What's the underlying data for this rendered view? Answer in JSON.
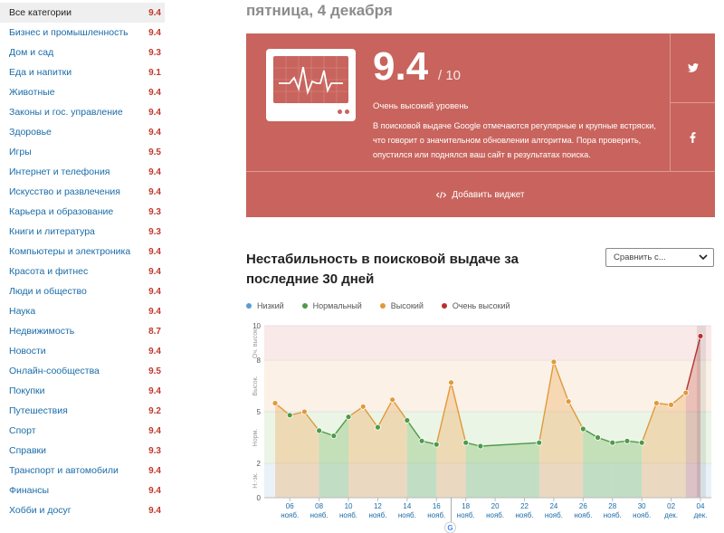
{
  "sidebar": {
    "categories": [
      {
        "label": "Все категории",
        "value": "9.4",
        "active": true
      },
      {
        "label": "Бизнес и промышленность",
        "value": "9.4"
      },
      {
        "label": "Дом и сад",
        "value": "9.3"
      },
      {
        "label": "Еда и напитки",
        "value": "9.1"
      },
      {
        "label": "Животные",
        "value": "9.4"
      },
      {
        "label": "Законы и гос. управление",
        "value": "9.4"
      },
      {
        "label": "Здоровье",
        "value": "9.4"
      },
      {
        "label": "Игры",
        "value": "9.5"
      },
      {
        "label": "Интернет и телефония",
        "value": "9.4"
      },
      {
        "label": "Искусство и развлечения",
        "value": "9.4"
      },
      {
        "label": "Карьера и образование",
        "value": "9.3"
      },
      {
        "label": "Книги и литература",
        "value": "9.3"
      },
      {
        "label": "Компьютеры и электроника",
        "value": "9.4"
      },
      {
        "label": "Красота и фитнес",
        "value": "9.4"
      },
      {
        "label": "Люди и общество",
        "value": "9.4"
      },
      {
        "label": "Наука",
        "value": "9.4"
      },
      {
        "label": "Недвижимость",
        "value": "8.7"
      },
      {
        "label": "Новости",
        "value": "9.4"
      },
      {
        "label": "Онлайн-сообщества",
        "value": "9.5"
      },
      {
        "label": "Покупки",
        "value": "9.4"
      },
      {
        "label": "Путешествия",
        "value": "9.2"
      },
      {
        "label": "Спорт",
        "value": "9.4"
      },
      {
        "label": "Справки",
        "value": "9.3"
      },
      {
        "label": "Транспорт и автомобили",
        "value": "9.4"
      },
      {
        "label": "Финансы",
        "value": "9.4"
      },
      {
        "label": "Хобби и досуг",
        "value": "9.4"
      }
    ]
  },
  "header": {
    "date": "пятница, 4 декабря"
  },
  "card": {
    "score": "9.4",
    "score_max": "/ 10",
    "level": "Очень высокий уровень",
    "description": "В поисковой выдаче Google отмечаются регулярные и крупные встряски, что говорит о значительном обновлении алгоритма. Пора проверить, опустился или поднялся ваш сайт в результатах поиска.",
    "widget_label": "Добавить виджет",
    "twitter_icon": "twitter-icon",
    "facebook_icon": "facebook-icon",
    "color": "#c8645d"
  },
  "chart_section": {
    "title": "Нестабильность в поисковой выдаче за последние 30 дней",
    "compare_placeholder": "Сравнить с..."
  },
  "chart_data": {
    "type": "area",
    "title": "Нестабильность в поисковой выдаче за последние 30 дней",
    "legend": [
      {
        "name": "Низкий",
        "color": "#5a9bd4"
      },
      {
        "name": "Нормальный",
        "color": "#4f9a48"
      },
      {
        "name": "Высокий",
        "color": "#e09a3a"
      },
      {
        "name": "Очень высокий",
        "color": "#b8312f"
      }
    ],
    "ylim": [
      0,
      10
    ],
    "y_ticks": [
      0,
      2,
      5,
      8,
      10
    ],
    "zones": [
      {
        "label": "Н.-зк.",
        "from": 0,
        "to": 2
      },
      {
        "label": "Норм.",
        "from": 2,
        "to": 5
      },
      {
        "label": "Высок.",
        "from": 5,
        "to": 8
      },
      {
        "label": "Оч. высок.",
        "from": 8,
        "to": 10
      }
    ],
    "x_ticks": [
      {
        "day": "06",
        "month": "нояб."
      },
      {
        "day": "08",
        "month": "нояб."
      },
      {
        "day": "10",
        "month": "нояб."
      },
      {
        "day": "12",
        "month": "нояб."
      },
      {
        "day": "14",
        "month": "нояб."
      },
      {
        "day": "16",
        "month": "нояб."
      },
      {
        "day": "18",
        "month": "нояб."
      },
      {
        "day": "20",
        "month": "нояб."
      },
      {
        "day": "22",
        "month": "нояб."
      },
      {
        "day": "24",
        "month": "нояб."
      },
      {
        "day": "26",
        "month": "нояб."
      },
      {
        "day": "28",
        "month": "нояб."
      },
      {
        "day": "30",
        "month": "нояб."
      },
      {
        "day": "02",
        "month": "дек."
      },
      {
        "day": "04",
        "month": "дек."
      }
    ],
    "x_dates": [
      "2020-11-05",
      "2020-11-06",
      "2020-11-07",
      "2020-11-08",
      "2020-11-09",
      "2020-11-10",
      "2020-11-11",
      "2020-11-12",
      "2020-11-13",
      "2020-11-14",
      "2020-11-15",
      "2020-11-16",
      "2020-11-17",
      "2020-11-18",
      "2020-11-19",
      "2020-11-23",
      "2020-11-24",
      "2020-11-25",
      "2020-11-26",
      "2020-11-27",
      "2020-11-28",
      "2020-11-29",
      "2020-11-30",
      "2020-12-01",
      "2020-12-02",
      "2020-12-03",
      "2020-12-04"
    ],
    "values": [
      5.5,
      4.8,
      5.0,
      3.9,
      3.6,
      4.7,
      5.3,
      4.1,
      5.7,
      4.5,
      3.3,
      3.1,
      6.7,
      3.2,
      3.0,
      3.2,
      7.9,
      5.6,
      4.0,
      3.5,
      3.2,
      3.3,
      3.2,
      5.5,
      5.4,
      6.1,
      9.4
    ]
  }
}
